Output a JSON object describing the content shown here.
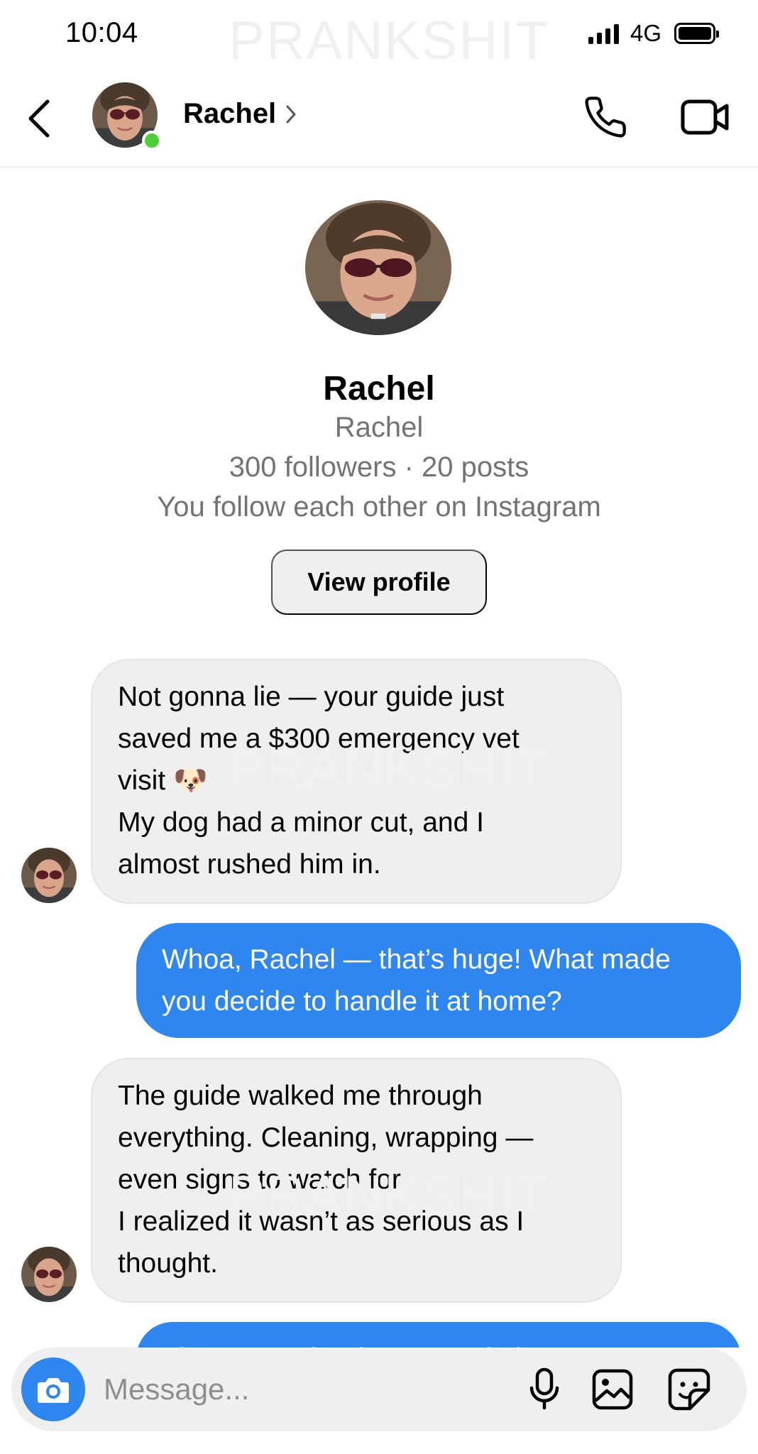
{
  "status_bar": {
    "time": "10:04",
    "network": "4G"
  },
  "watermark_text": "PRANKSHIT",
  "header": {
    "contact_name": "Rachel",
    "online": true,
    "icons": [
      "back-arrow-icon",
      "chevron-right-icon",
      "phone-icon",
      "video-camera-icon"
    ]
  },
  "profile": {
    "name": "Rachel",
    "username": "Rachel",
    "stats": "300 followers · 20 posts",
    "mutual": "You follow each other on Instagram",
    "view_profile_label": "View profile"
  },
  "messages": [
    {
      "direction": "incoming",
      "lines": [
        "Not gonna lie — your guide just",
        "saved me a $300 emergency vet",
        "visit 🐶",
        "My dog had a minor cut, and I",
        "almost rushed him in."
      ]
    },
    {
      "direction": "outgoing",
      "lines": [
        "Whoa, Rachel — that’s huge! What made",
        "you decide to handle it at home?"
      ]
    },
    {
      "direction": "incoming",
      "lines": [
        "The guide walked me through",
        "everything. Cleaning, wrapping —",
        "even signs to watch for.",
        "I realized it wasn’t as serious as I",
        "thought."
      ]
    },
    {
      "direction": "outgoing",
      "lines": [
        "That’s exactly why we made it. You’re"
      ]
    }
  ],
  "composer": {
    "placeholder": "Message...",
    "icons": [
      "camera-icon",
      "microphone-icon",
      "gallery-icon",
      "sticker-icon"
    ]
  },
  "colors": {
    "accent_blue": "#2f86ef",
    "incoming_bubble": "#efefef",
    "online_green": "#4cd137",
    "secondary_text": "#737373"
  }
}
